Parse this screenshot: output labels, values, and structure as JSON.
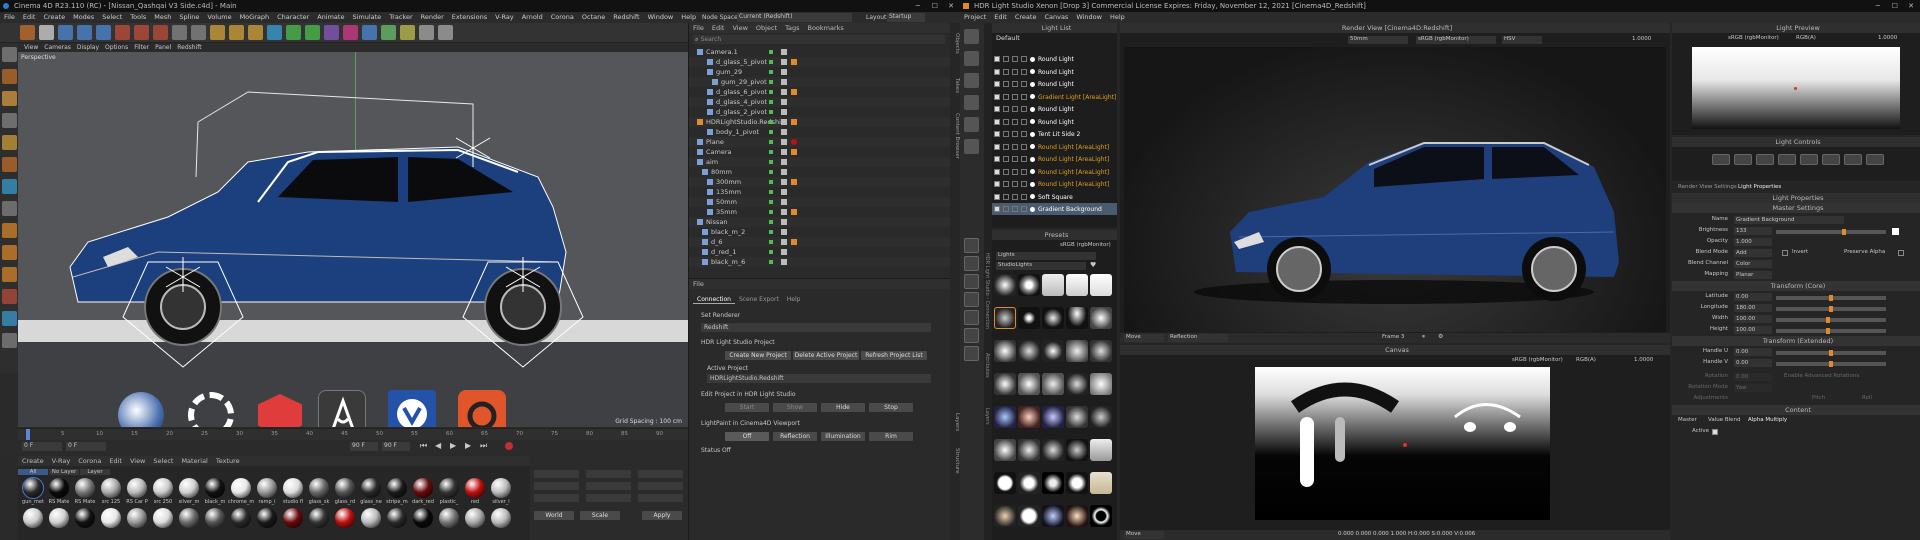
{
  "c4d": {
    "title": "Cinema 4D R23.110 (RC) - [Nissan_Qashqai V3 Side.c4d] - Main",
    "menu": [
      "File",
      "Edit",
      "Create",
      "Modes",
      "Select",
      "Tools",
      "Mesh",
      "Spline",
      "Volume",
      "MoGraph",
      "Character",
      "Animate",
      "Simulate",
      "Tracker",
      "Render",
      "Extensions",
      "V-Ray",
      "Arnold",
      "Corona",
      "Octane",
      "Redshift",
      "Window",
      "Help"
    ],
    "node_space_label": "Node Space:",
    "node_space_value": "Current (Redshift)",
    "layout_label": "Layout:",
    "layout_value": "Startup",
    "viewport_menu": [
      "View",
      "Cameras",
      "Display",
      "Options",
      "Filter",
      "Panel",
      "Redshift"
    ],
    "viewport_name": "Perspective",
    "grid_spacing": "Grid Spacing : 100 cm",
    "timeline_ticks": [
      "0",
      "5",
      "10",
      "15",
      "20",
      "25",
      "30",
      "35",
      "40",
      "45",
      "50",
      "55",
      "60",
      "65",
      "70",
      "75",
      "80",
      "85",
      "90"
    ],
    "frame_current": "0 F",
    "frame_start": "0 F",
    "frame_end": "90 F",
    "frame_end2": "90 F",
    "material_menu": [
      "Create",
      "V-Ray",
      "Corona",
      "Edit",
      "View",
      "Select",
      "Material",
      "Texture"
    ],
    "material_filters": [
      "All",
      "No Layer",
      "Layer"
    ],
    "materials_row1": [
      "gun_met",
      "RS Mate",
      "RS Mate",
      "src 125",
      "RS Car P",
      "src 250",
      "silver_m",
      "black_m",
      "chrome_m",
      "ramp_i",
      "studio fl",
      "glass_sk",
      "glass_rd",
      "glass_ne",
      "stripe_m",
      "dark_red",
      "plastic_",
      "red",
      "silver_i"
    ],
    "coord_apply": "Apply",
    "coord_world": "World",
    "coord_scale": "Scale",
    "objects_menu": [
      "File",
      "Edit",
      "View",
      "Object",
      "Tags",
      "Bookmarks"
    ],
    "objects_search": "Search",
    "objects": [
      "Camera.1",
      "d_glass_5_pivot",
      "gum_29",
      "gum_29_pivot",
      "d_glass_6_pivot",
      "d_glass_4_pivot",
      "d_glass_2_pivot",
      "HDRLightStudio.Redshift",
      "body_1_pivot",
      "Plane",
      "Camera",
      "aim",
      "80mm",
      "300mm",
      "135mm",
      "50mm",
      "35mm",
      "Nissan",
      "black_m_2",
      "d_6",
      "d_red_1",
      "black_m_6"
    ],
    "attr_tab": "File",
    "attr_tabs": [
      "Connection",
      "Scene Export",
      "Help"
    ],
    "set_renderer_label": "Set Renderer",
    "set_renderer_value": "Redshift",
    "hdr_project_label": "HDR Light Studio Project",
    "btn_create_project": "Create New Project",
    "btn_delete_project": "Delete Active Project",
    "btn_refresh_list": "Refresh Project List",
    "active_project_label": "Active Project",
    "active_project_value": "HDRLightStudio.Redshift",
    "edit_project_label": "Edit Project in HDR Light Studio",
    "btn_start": "Start",
    "btn_show": "Show",
    "btn_hide": "Hide",
    "btn_stop": "Stop",
    "lightpaint_label": "LightPaint in Cinema4D Viewport",
    "btn_off": "Off",
    "btn_reflection": "Reflection",
    "btn_illumination": "Illumination",
    "btn_rim": "Rim",
    "status_label": "Status Off",
    "side_tabs": [
      "Objects",
      "Takes",
      "Content Browser",
      "Layers",
      "Structure"
    ]
  },
  "hdr": {
    "title": "HDR Light Studio Xenon [Drop 3] Commercial License Expires: Friday, November 12, 2021 [Cinema4D_Redshift]",
    "menu": [
      "Project",
      "Edit",
      "Create",
      "Canvas",
      "Window",
      "Help"
    ],
    "light_list_title": "Light List",
    "light_list_default": "Default",
    "lights": [
      {
        "name": "Round Light",
        "color": "#ffffff"
      },
      {
        "name": "Round Light",
        "color": "#ffffff"
      },
      {
        "name": "Round Light",
        "color": "#ffffff"
      },
      {
        "name": "Gradient Light [AreaLight]",
        "color": "#e0a020"
      },
      {
        "name": "Round Light",
        "color": "#ffffff"
      },
      {
        "name": "Round Light",
        "color": "#ffffff"
      },
      {
        "name": "Tent Lit Side 2",
        "color": "#ffffff"
      },
      {
        "name": "Round Light [AreaLight]",
        "color": "#e0a020"
      },
      {
        "name": "Round Light [AreaLight]",
        "color": "#e0a020"
      },
      {
        "name": "Round Light [AreaLight]",
        "color": "#e0a020"
      },
      {
        "name": "Round Light [AreaLight]",
        "color": "#e0a020"
      },
      {
        "name": "Soft Square",
        "color": "#ffffff"
      },
      {
        "name": "Gradient Background",
        "color": "#ffffff"
      }
    ],
    "presets_title": "Presets",
    "presets_colorspace": "sRGB (rgbMonitor)",
    "presets_category": "Lights",
    "presets_sub": "StudioLights",
    "render_view_title": "Render View [Cinema4D:Redshift]",
    "render_lens": "50mm",
    "render_colorspace": "sRGB (rgbMonitor)",
    "render_mode": "HSV",
    "render_exposure": "1.0000",
    "render_move": "Move",
    "render_reflection": "Reflection",
    "render_frame": "Frame 3",
    "canvas_title": "Canvas",
    "canvas_colorspace": "sRGB (rgbMonitor)",
    "canvas_channel": "RGB(A)",
    "canvas_exposure": "1.0000",
    "canvas_move": "Move",
    "canvas_readout": "0.000  0.000  0.000  1.000    H:0.000 S:0.000 V:0.006",
    "light_preview_title": "Light Preview",
    "light_preview_colorspace": "sRGB (rgbMonitor)",
    "light_preview_channel": "RGB(A)",
    "light_preview_exposure": "1.0000",
    "light_controls_title": "Light Controls",
    "props_tabs": [
      "Render View Settings",
      "Light Properties"
    ],
    "props_title": "Light Properties",
    "master_settings": "Master Settings",
    "name_label": "Name",
    "name_value": "Gradient Background",
    "brightness_label": "Brightness",
    "brightness_value": "133",
    "opacity_label": "Opacity",
    "opacity_value": "1.000",
    "blend_mode_label": "Blend Mode",
    "blend_mode_value": "Add",
    "invert_label": "Invert",
    "preserve_alpha_label": "Preserve Alpha",
    "blend_channel_label": "Blend Channel",
    "blend_channel_value": "Color",
    "mapping_label": "Mapping",
    "mapping_value": "Planar",
    "transform_core": "Transform (Core)",
    "latitude_label": "Latitude",
    "latitude_value": "0.00",
    "longitude_label": "Longitude",
    "longitude_value": "180.00",
    "width_label": "Width",
    "width_value": "100.00",
    "height_label": "Height",
    "height_value": "100.00",
    "transform_ext": "Transform (Extended)",
    "handle_u_label": "Handle U",
    "handle_u_value": "0.00",
    "handle_v_label": "Handle V",
    "handle_v_value": "0.00",
    "rotation_label": "Rotation",
    "rotation_value": "0.00",
    "enable_adv_rot": "Enable Advanced Rotations",
    "rotation_mode_label": "Rotation Mode",
    "rotation_mode_value": "Yaw",
    "adjustments_label": "Adjustments",
    "pitch_label": "Pitch",
    "roll_label": "Roll",
    "content_hdr": "Content",
    "master_label": "Master",
    "value_blend_label": "Value Blend",
    "alpha_multiply_label": "Alpha Multiply",
    "active_label": "Active",
    "side_label": "HDR Light Studio - Connection",
    "side_label2": "Attributes",
    "side_label3": "Layers"
  },
  "colors": {
    "accent_orange": "#e08a2a",
    "car_blue": "#1c3f7d",
    "selected_row": "#4a5a70"
  }
}
